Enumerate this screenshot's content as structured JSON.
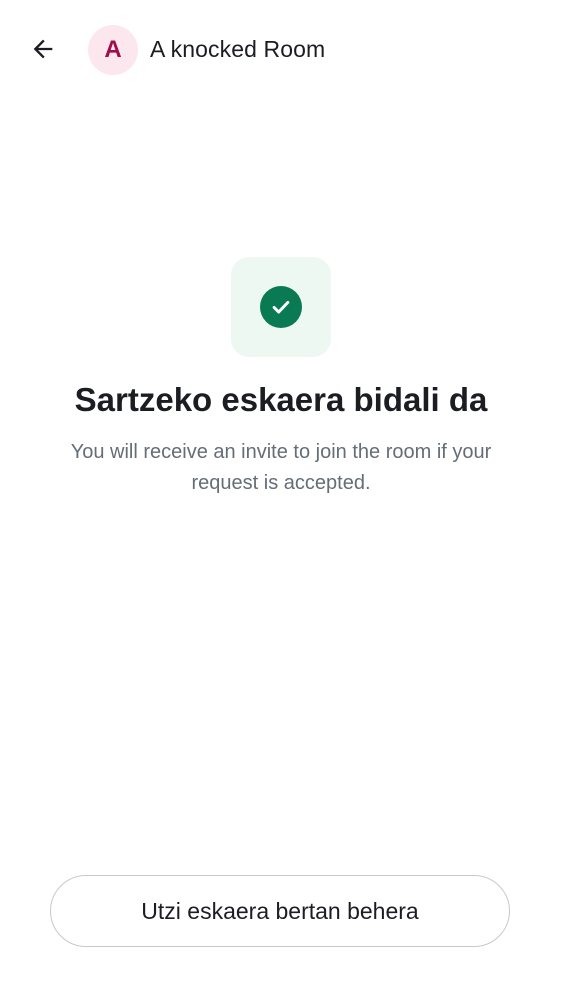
{
  "header": {
    "back_icon": "arrow-left-icon",
    "avatar_initial": "A",
    "room_name": "A knocked Room"
  },
  "status": {
    "icon": "check-circle-icon",
    "title": "Sartzeko eskaera bidali da",
    "message": "You will receive an invite to join the room if your request is accepted."
  },
  "actions": {
    "cancel_label": "Utzi eskaera bertan behera"
  },
  "colors": {
    "accent_green": "#0a7a55",
    "tile_bg": "#eef8f3",
    "avatar_bg": "#fde7ef",
    "avatar_text": "#a00f4c"
  }
}
